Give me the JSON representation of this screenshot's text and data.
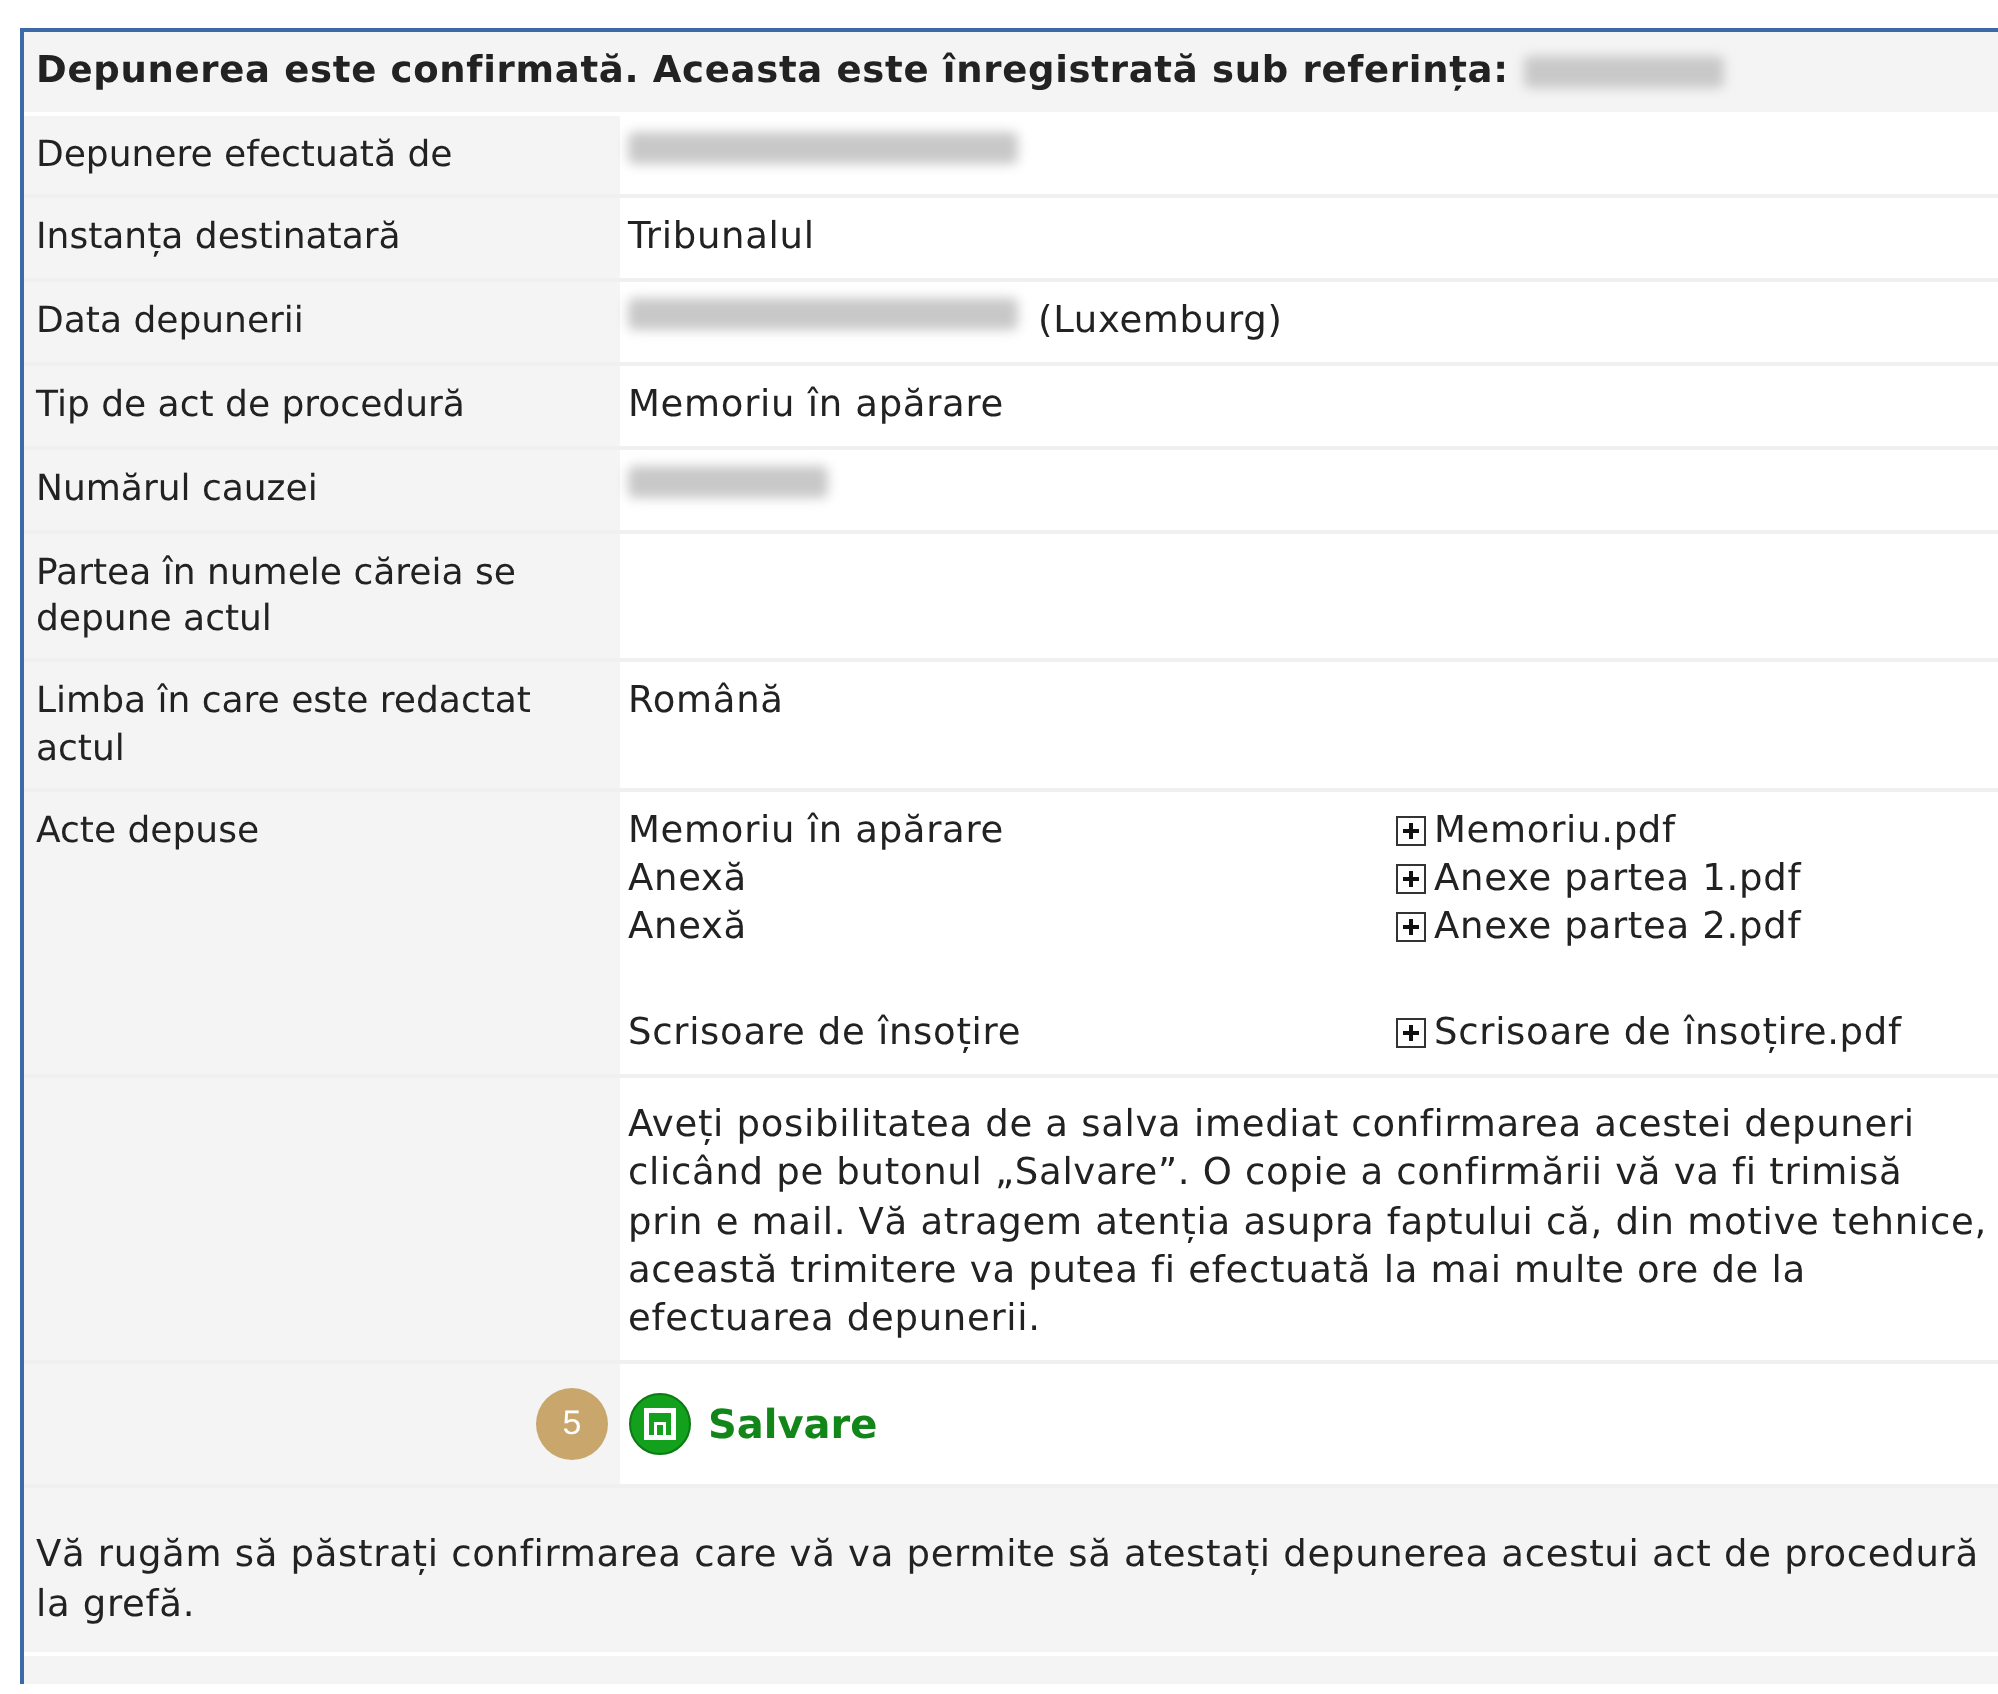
{
  "header": {
    "title": "Depunerea este confirmată. Aceasta este înregistrată sub referința:",
    "reference_redacted": true
  },
  "fields": [
    {
      "label": "Depunere efectuată de",
      "value_redacted": true
    },
    {
      "label": "Instanța destinatară",
      "value": "Tribunalul"
    },
    {
      "label": "Data depunerii",
      "value_redacted": true,
      "suffix": "(Luxemburg)"
    },
    {
      "label": "Tip de act de procedură",
      "value": "Memoriu în apărare"
    },
    {
      "label": "Numărul cauzei",
      "value_redacted": true
    },
    {
      "label": "Partea în numele căreia se depune actul"
    },
    {
      "label": "Limba în care este redactat actul",
      "value": "Română"
    }
  ],
  "documents": {
    "label": "Acte depuse",
    "items": [
      {
        "kind": "document",
        "type": "Memoriu în apărare",
        "file": "Memoriu.pdf"
      },
      {
        "kind": "document",
        "type": "Anexă",
        "file": "Anexe partea 1.pdf"
      },
      {
        "kind": "document",
        "type": "Anexă",
        "file": "Anexe partea 2.pdf"
      },
      {
        "kind": "cover_letter",
        "type": "Scrisoare de însoțire",
        "file": "Scrisoare de însoțire.pdf"
      }
    ]
  },
  "save_info": "Aveți posibilitatea de a salva imediat confirmarea acestei depuneri clicând pe butonul „Salvare”. O copie a confirmării vă va fi trimisă prin e mail. Vă atragem atenția asupra faptului că, din motive tehnice, această trimitere va putea fi efectuată la mai multe ore de la efectuarea depunerii.",
  "callout": "5",
  "save_button": "Salvare",
  "footer_note": "Vă rugăm să păstrați confirmarea care vă va permite să atestați depunerea acestui act de procedură la grefă."
}
